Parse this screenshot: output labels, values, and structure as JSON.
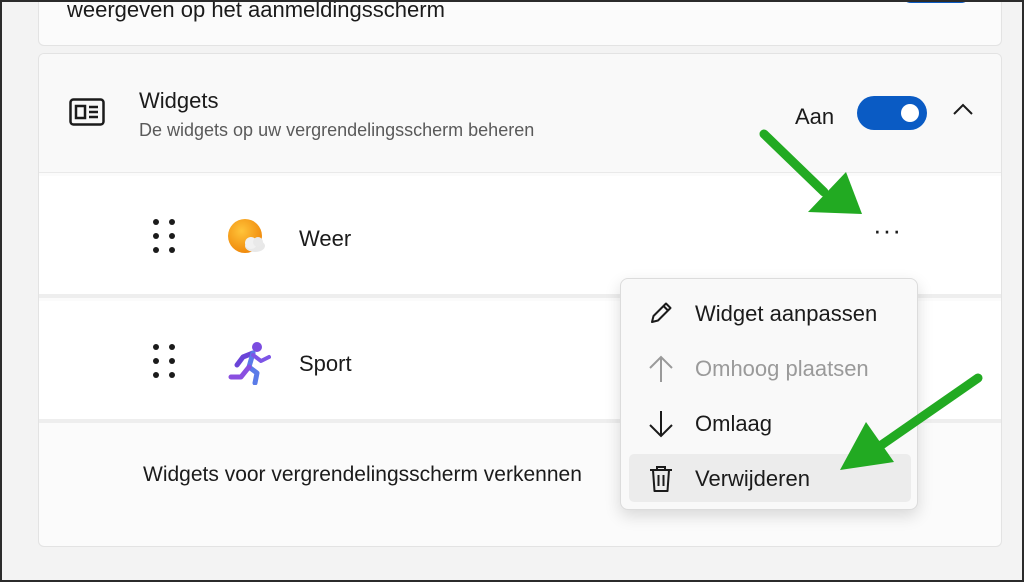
{
  "top_card": {
    "text": "weergeven op het aanmeldingsscherm"
  },
  "widgets_section": {
    "title": "Widgets",
    "subtitle": "De widgets op uw vergrendelingsscherm beheren",
    "state_label": "Aan",
    "toggle_on": true,
    "expanded": true,
    "icon": "widget-panel-icon",
    "items": [
      {
        "label": "Weer",
        "icon": "weather-sun-cloud-icon"
      },
      {
        "label": "Sport",
        "icon": "runner-icon"
      }
    ],
    "explore_text": "Widgets voor vergrendelingsscherm verkennen"
  },
  "context_menu": {
    "items": [
      {
        "label": "Widget aanpassen",
        "icon": "pencil-icon",
        "enabled": true
      },
      {
        "label": "Omhoog plaatsen",
        "icon": "arrow-up-icon",
        "enabled": false
      },
      {
        "label": "Omlaag",
        "icon": "arrow-down-icon",
        "enabled": true
      },
      {
        "label": "Verwijderen",
        "icon": "trash-icon",
        "enabled": true,
        "highlighted": true
      }
    ]
  },
  "colors": {
    "accent": "#0a5bc4",
    "annotation_arrow": "#22aa22",
    "background": "#f3f3f3",
    "card": "#fbfbfb"
  }
}
